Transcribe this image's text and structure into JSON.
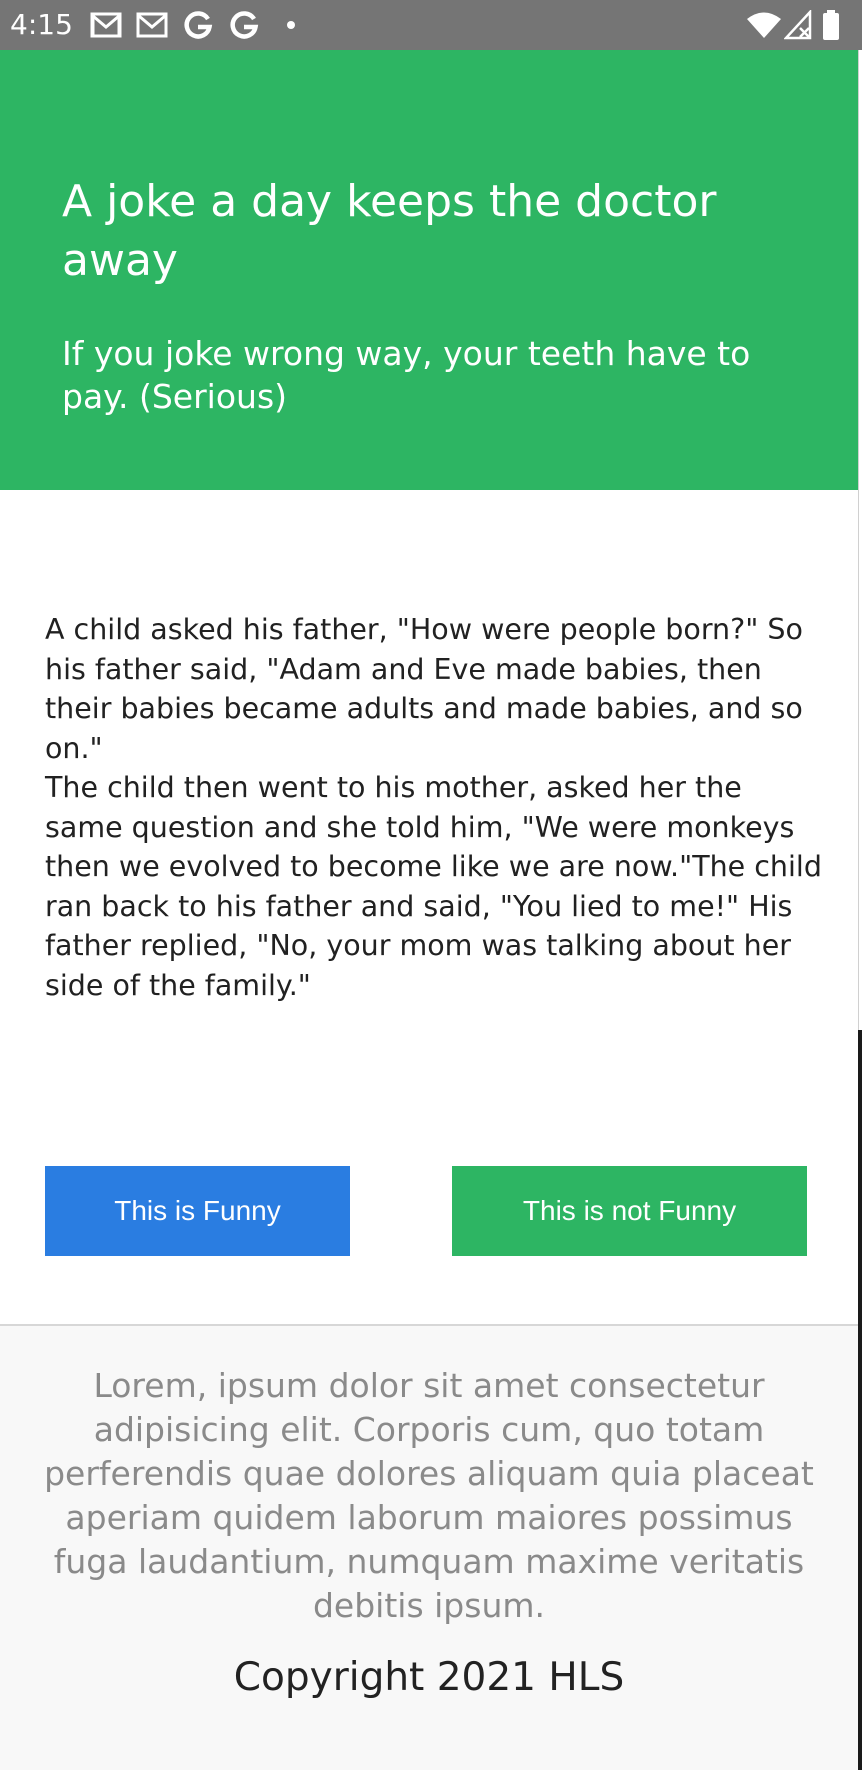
{
  "status_bar": {
    "time": "4:15",
    "left_icons": [
      "gmail-icon",
      "gmail-icon",
      "google-icon",
      "google-icon",
      "notification-dot-icon"
    ],
    "right_icons": [
      "wifi-icon",
      "cell-signal-icon",
      "battery-icon"
    ],
    "background": "#757575"
  },
  "hero": {
    "title": "A joke a day keeps the doctor away",
    "subtitle": "If you joke wrong way, your teeth have to pay. (Serious)",
    "background": "#2db563"
  },
  "joke": {
    "text": "A child asked his father, \"How were people born?\" So his father said, \"Adam and Eve made babies, then their babies became adults and made babies, and so on.\"\nThe child then went to his mother, asked her the same question and she told him, \"We were monkeys then we evolved to become like we are now.\"The child ran back to his father and said, \"You lied to me!\" His father replied, \"No, your mom was talking about her side of the family.\""
  },
  "buttons": {
    "funny_label": "This is Funny",
    "not_funny_label": "This is not Funny",
    "funny_color": "#2a7de1",
    "not_funny_color": "#2db563"
  },
  "footer": {
    "text": "Lorem, ipsum dolor sit amet consectetur adipisicing elit. Corporis cum, quo totam perferendis quae dolores aliquam quia placeat aperiam quidem laborum maiores possimus fuga laudantium, numquam maxime veritatis debitis ipsum.",
    "copyright": "Copyright 2021 HLS"
  }
}
